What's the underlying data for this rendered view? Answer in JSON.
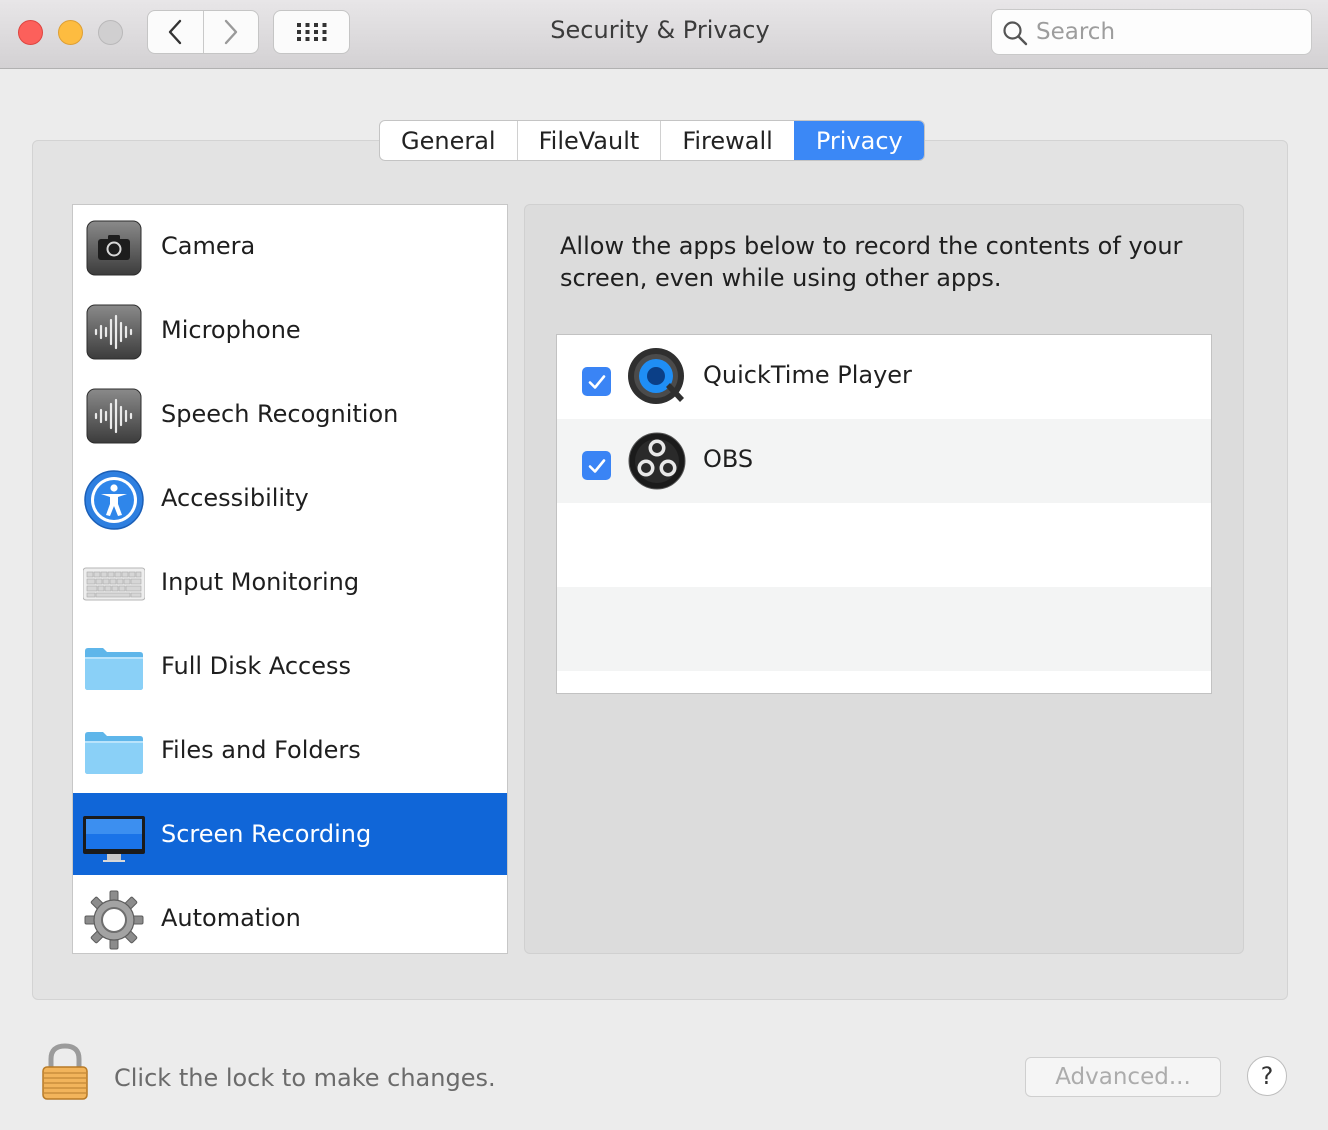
{
  "window": {
    "title": "Security & Privacy",
    "search_placeholder": "Search"
  },
  "toolbar": {
    "back_icon": "chevron-left-icon",
    "forward_icon": "chevron-right-icon",
    "show_all_icon": "grid-icon"
  },
  "tabs": [
    {
      "label": "General",
      "active": false
    },
    {
      "label": "FileVault",
      "active": false
    },
    {
      "label": "Firewall",
      "active": false
    },
    {
      "label": "Privacy",
      "active": true
    }
  ],
  "sidebar": {
    "items": [
      {
        "label": "Camera",
        "icon": "camera-icon"
      },
      {
        "label": "Microphone",
        "icon": "microphone-icon"
      },
      {
        "label": "Speech Recognition",
        "icon": "speech-recognition-icon"
      },
      {
        "label": "Accessibility",
        "icon": "accessibility-icon"
      },
      {
        "label": "Input Monitoring",
        "icon": "keyboard-icon"
      },
      {
        "label": "Full Disk Access",
        "icon": "folder-icon"
      },
      {
        "label": "Files and Folders",
        "icon": "folder-icon"
      },
      {
        "label": "Screen Recording",
        "icon": "display-icon",
        "selected": true
      },
      {
        "label": "Automation",
        "icon": "gear-icon"
      }
    ]
  },
  "main": {
    "description": "Allow the apps below to record the contents of your screen, even while using other apps.",
    "apps": [
      {
        "name": "QuickTime Player",
        "checked": true,
        "icon": "quicktime-icon"
      },
      {
        "name": "OBS",
        "checked": true,
        "icon": "obs-icon"
      }
    ]
  },
  "footer": {
    "lock_text": "Click the lock to make changes.",
    "advanced_label": "Advanced...",
    "help_label": "?"
  },
  "colors": {
    "accent": "#3b88f6",
    "selection": "#1066d8"
  }
}
